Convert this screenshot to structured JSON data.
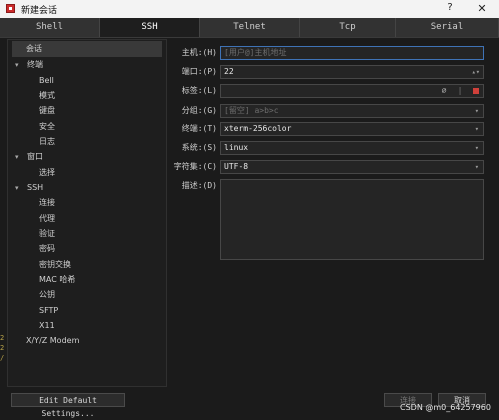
{
  "window": {
    "title": "新建会话",
    "help": "?",
    "close": "✕"
  },
  "tabs": [
    {
      "label": "Shell",
      "active": false
    },
    {
      "label": "SSH",
      "active": true
    },
    {
      "label": "Telnet",
      "active": false
    },
    {
      "label": "Tcp",
      "active": false
    },
    {
      "label": "Serial",
      "active": false
    }
  ],
  "tree": {
    "session": "会话",
    "terminal": "终端",
    "bell": "Bell",
    "mode": "模式",
    "keyboard": "键盘",
    "security": "安全",
    "log": "日志",
    "window": "窗口",
    "select": "选择",
    "ssh": "SSH",
    "connect": "连接",
    "proxy": "代理",
    "auth": "验证",
    "password": "密码",
    "key_exchange": "密钥交换",
    "mac_hash": "MAC 哈希",
    "public_key": "公钥",
    "sftp": "SFTP",
    "x11": "X11",
    "xyz_modem": "X/Y/Z Modem"
  },
  "form": {
    "host_label": "主机:(H)",
    "host_placeholder": "[用户@]主机地址",
    "port_label": "端口:(P)",
    "port_value": "22",
    "tag_label": "标签:(L)",
    "group_label": "分组:(G)",
    "group_placeholder": "[留空]  a>b>c",
    "terminal_label": "终端:(T)",
    "terminal_value": "xterm-256color",
    "system_label": "系统:(S)",
    "system_value": "linux",
    "charset_label": "字符集:(C)",
    "charset_value": "UTF-8",
    "desc_label": "描述:(D)"
  },
  "buttons": {
    "edit_defaults": "Edit Default Settings...",
    "connect": "连接",
    "cancel": "取消"
  },
  "watermark": "CSDN @m0_64257960",
  "left_edge": [
    "2",
    "2",
    "/"
  ],
  "colors": {
    "accent": "#3f73b6",
    "tag_color": "#d0403a"
  }
}
